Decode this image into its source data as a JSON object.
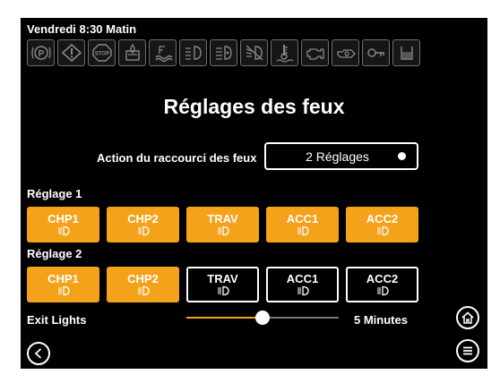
{
  "status": {
    "datetime": "Vendredi 8:30 Matin"
  },
  "telltales": [
    "parking-brake-icon",
    "warning-icon",
    "stop-icon",
    "fuel-water-icon",
    "coolant-level-icon",
    "low-beam-icon",
    "high-beam-icon",
    "fog-off-icon",
    "coolant-temp-icon",
    "engine-check-icon",
    "oil-pressure-icon",
    "key-icon",
    "fuel-level-icon"
  ],
  "page": {
    "title": "Réglages des feux"
  },
  "shortcut": {
    "label": "Action du raccourci des feux",
    "value": "2 Réglages"
  },
  "settings": [
    {
      "label": "Réglage 1",
      "lights": [
        {
          "label": "CHP1",
          "active": true
        },
        {
          "label": "CHP2",
          "active": true
        },
        {
          "label": "TRAV",
          "active": true
        },
        {
          "label": "ACC1",
          "active": true
        },
        {
          "label": "ACC2",
          "active": true
        }
      ]
    },
    {
      "label": "Réglage 2",
      "lights": [
        {
          "label": "CHP1",
          "active": true
        },
        {
          "label": "CHP2",
          "active": true
        },
        {
          "label": "TRAV",
          "active": false
        },
        {
          "label": "ACC1",
          "active": false
        },
        {
          "label": "ACC2",
          "active": false
        }
      ]
    }
  ],
  "exit_lights": {
    "label": "Exit Lights",
    "value_text": "5 Minutes",
    "level": 0.5
  },
  "nav": {
    "home_icon": "home-icon",
    "menu_icon": "menu-icon",
    "back_icon": "back-icon"
  },
  "colors": {
    "accent": "#f5a21b",
    "background": "#000000",
    "text": "#ffffff"
  }
}
